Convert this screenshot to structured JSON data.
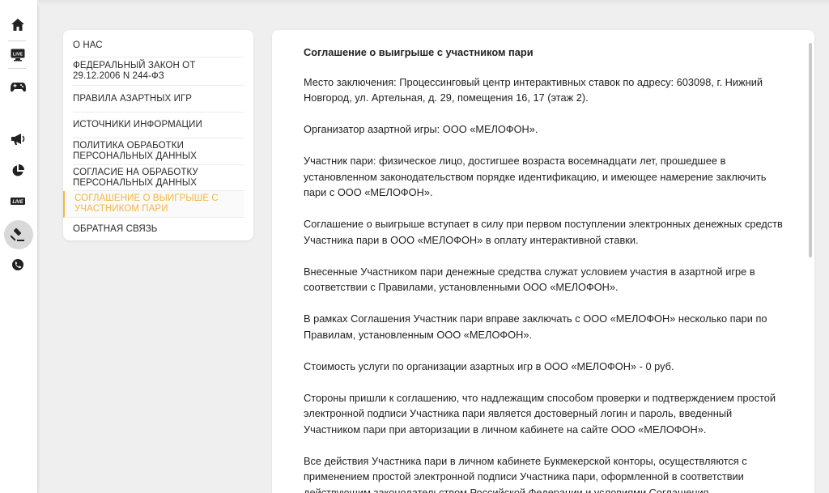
{
  "rail": {
    "icons": [
      {
        "name": "home-icon"
      },
      {
        "name": "live-tv-icon",
        "text": "LIVE"
      },
      {
        "name": "gamepad-icon"
      },
      {
        "name": "megaphone-icon"
      },
      {
        "name": "pie-chart-icon"
      },
      {
        "name": "live-badge-icon",
        "text": "LIVE"
      },
      {
        "name": "gavel-icon",
        "active": true
      },
      {
        "name": "support-chat-icon"
      }
    ]
  },
  "menu": {
    "items": [
      {
        "label": "О НАС"
      },
      {
        "label": "ФЕДЕРАЛЬНЫЙ ЗАКОН ОТ 29.12.2006 N 244-ФЗ"
      },
      {
        "label": "ПРАВИЛА АЗАРТНЫХ ИГР"
      },
      {
        "label": "ИСТОЧНИКИ ИНФОРМАЦИИ"
      },
      {
        "label": "ПОЛИТИКА ОБРАБОТКИ ПЕРСОНАЛЬНЫХ ДАННЫХ"
      },
      {
        "label": "СОГЛАСИЕ НА ОБРАБОТКУ ПЕРСОНАЛЬНЫХ ДАННЫХ"
      },
      {
        "label": "СОГЛАШЕНИЕ О ВЫИГРЫШЕ С УЧАСТНИКОМ ПАРИ"
      },
      {
        "label": "ОБРАТНАЯ СВЯЗЬ"
      }
    ],
    "active_color": "#f5b73c"
  },
  "document": {
    "title": "Соглашение о выигрыше с участником пари",
    "paragraphs": [
      "Место заключения: Процессинговый центр интерактивных ставок по адресу: 603098, г. Нижний Новгород, ул. Артельная, д. 29, помещения 16, 17 (этаж 2).",
      "Организатор азартной игры: ООО «МЕЛОФОН».",
      "Участник пари: физическое лицо, достигшее возраста восемнадцати лет, прошедшее в установленном законодательством порядке идентификацию, и имеющее намерение заключить пари с ООО «МЕЛОФОН».",
      "Соглашение о выигрыше вступает в силу при первом поступлении электронных денежных средств Участника пари в ООО «МЕЛОФОН» в оплату интерактивной ставки.",
      "Внесенные Участником пари денежные средства служат условием участия в азартной игре в соответствии с Правилами, установленными ООО «МЕЛОФОН».",
      "В рамках Соглашения Участник пари вправе заключать с ООО «МЕЛОФОН» несколько пари по Правилам, установленным ООО «МЕЛОФОН».",
      "Стоимость услуги по организации азартных игр в ООО «МЕЛОФОН» - 0 руб.",
      "Стороны пришли к соглашению, что надлежащим способом проверки и подтверждением простой электронной подписи Участника пари является достоверный логин и пароль, введенный Участником пари при авторизации в личном кабинете на сайте ООО «МЕЛОФОН».",
      "Все действия Участника пари в личном кабинете Букмекерской конторы, осуществляются с применением простой электронной подписи Участника пари, оформленной в соответствии действующим законодательством Российской Федерации и условиями Соглашения."
    ]
  }
}
